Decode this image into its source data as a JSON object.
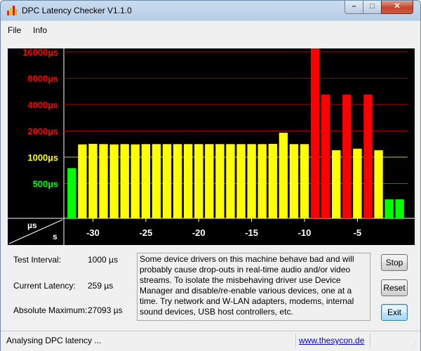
{
  "window": {
    "title": "DPC Latency Checker V1.1.0",
    "icon": "bar-chart-icon"
  },
  "window_controls": {
    "minimize": "–",
    "maximize": "□",
    "close": "✕"
  },
  "menu": {
    "items": [
      "File",
      "Info"
    ]
  },
  "chart_data": {
    "type": "bar",
    "y_tick_labels": [
      {
        "text": "16000µs",
        "value": 16000,
        "color": "#ff0000",
        "gridline": "#b00000"
      },
      {
        "text": "8000µs",
        "value": 8000,
        "color": "#ff0000",
        "gridline": "#b00000"
      },
      {
        "text": "4000µs",
        "value": 4000,
        "color": "#ff0000",
        "gridline": "#b00000"
      },
      {
        "text": "2000µs",
        "value": 2000,
        "color": "#ff0000",
        "gridline": "#b00000"
      },
      {
        "text": "1000µs",
        "value": 1000,
        "color": "#ffff00",
        "gridline": "#c8c800"
      },
      {
        "text": "500µs",
        "value": 500,
        "color": "#00ff00",
        "gridline": "#00a000"
      }
    ],
    "y_scale": "log2",
    "y_max": 17500,
    "x_axis_unit": "s",
    "y_axis_unit": "µs",
    "x_ticks": [
      -30,
      -25,
      -20,
      -15,
      -10,
      -5
    ],
    "x_range": [
      -32.75,
      -0.25
    ],
    "x": [
      -32,
      -31,
      -30,
      -29,
      -28,
      -27,
      -26,
      -25,
      -24,
      -23,
      -22,
      -21,
      -20,
      -19,
      -18,
      -17,
      -16,
      -15,
      -14,
      -13,
      -12,
      -11,
      -10,
      -9,
      -8,
      -7,
      -6,
      -5,
      -4,
      -3,
      -2,
      -1
    ],
    "values_us": [
      750,
      1400,
      1420,
      1410,
      1400,
      1410,
      1400,
      1410,
      1410,
      1410,
      1410,
      1410,
      1410,
      1410,
      1410,
      1410,
      1410,
      1410,
      1410,
      1420,
      1900,
      1410,
      1410,
      27093,
      5200,
      1200,
      5200,
      1250,
      5200,
      1200,
      330,
      330
    ],
    "colors": {
      "ok": "#00ff00",
      "warn": "#ffff00",
      "bad": "#ff0000",
      "background": "#000000"
    }
  },
  "stats": {
    "test_interval_label": "Test Interval:",
    "test_interval_value": "1000 µs",
    "current_latency_label": "Current Latency:",
    "current_latency_value": "259 µs",
    "absolute_maximum_label": "Absolute Maximum:",
    "absolute_maximum_value": "27093 µs"
  },
  "message": "Some device drivers on this machine behave bad and will probably cause drop-outs in real-time audio and/or video streams. To isolate the misbehaving driver use Device Manager and disable/re-enable various devices, one at a time. Try network and W-LAN adapters, modems, internal sound devices, USB host controllers, etc.",
  "buttons": {
    "stop": "Stop",
    "reset": "Reset",
    "exit": "Exit"
  },
  "status": {
    "text": "Analysing DPC latency ...",
    "link": "www.thesycon.de"
  }
}
